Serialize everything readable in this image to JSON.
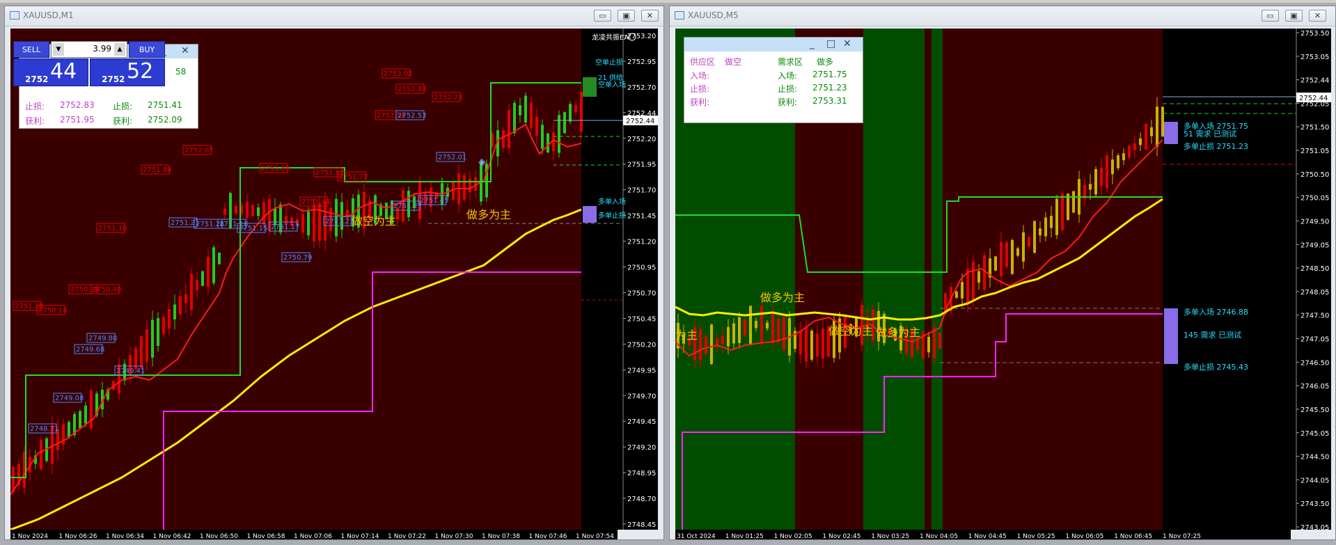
{
  "windows": [
    {
      "title": "XAUUSD,M1",
      "ea_label": "龙凌共振EA",
      "price_axis": [
        "2753.20",
        "2752.95",
        "2752.70",
        "2752.44",
        "2752.20",
        "2751.95",
        "2751.70",
        "2751.45",
        "2751.20",
        "2750.95",
        "2750.70",
        "2750.45",
        "2750.20",
        "2749.95",
        "2749.70",
        "2749.45",
        "2749.20",
        "2748.95",
        "2748.70",
        "2748.45"
      ],
      "current_price": "2752.44",
      "time_axis": [
        "1 Nov 2024",
        "1 Nov 06:26",
        "1 Nov 06:34",
        "1 Nov 06:42",
        "1 Nov 06:50",
        "1 Nov 06:58",
        "1 Nov 07:06",
        "1 Nov 07:14",
        "1 Nov 07:22",
        "1 Nov 07:30",
        "1 Nov 07:38",
        "1 Nov 07:46",
        "1 Nov 07:54"
      ],
      "trade_panel": {
        "sell_label": "SELL",
        "buy_label": "BUY",
        "lot": "3.99",
        "sell_small": "2752",
        "sell_big": "44",
        "buy_small": "2752",
        "buy_big": "52",
        "partial_value": "58"
      },
      "info": {
        "sl_left_label": "止损:",
        "sl_left_value": "2752.83",
        "tp_left_label": "获利:",
        "tp_left_value": "2751.95",
        "sl_right_label": "止损:",
        "sl_right_value": "2751.41",
        "tp_right_label": "获利:",
        "tp_right_value": "2752.09"
      },
      "red_labels": [
        "2753.02",
        "2752.83",
        "2752.73",
        "2752.54",
        "2752.07",
        "2751.84",
        "2751.89",
        "2751.82",
        "2751.73",
        "2751.48",
        "2751.10",
        "2750.39",
        "2750.40",
        "2750.14",
        "2751.28"
      ],
      "blue_labels": [
        "2752.53",
        "2752.01",
        "2751.45",
        "2751.27",
        "2751.21",
        "2751.26",
        "2751.18",
        "2751.15",
        "2751.17",
        "2751.23",
        "2750.79",
        "2749.80",
        "2749.68",
        "2749.41",
        "2749.08",
        "2748.71"
      ],
      "chart_text": {
        "short_bias": "做空为主",
        "long_bias": "做多为主"
      },
      "right_labels": [
        "空单止损",
        "21 供给",
        "空单入场",
        "多单入场",
        "多单止损"
      ]
    },
    {
      "title": "XAUUSD,M5",
      "price_axis": [
        "2753.50",
        "2753.05",
        "2752.44",
        "2752.05",
        "2751.50",
        "2751.05",
        "2750.50",
        "2750.05",
        "2749.50",
        "2749.05",
        "2748.50",
        "2748.05",
        "2747.50",
        "2747.05",
        "2746.50",
        "2746.05",
        "2745.50",
        "2745.05",
        "2744.50",
        "2744.05",
        "2743.50",
        "2743.05"
      ],
      "current_price": "2752.44",
      "time_axis": [
        "31 Oct 2024",
        "1 Nov 01:25",
        "1 Nov 02:05",
        "1 Nov 02:45",
        "1 Nov 03:25",
        "1 Nov 04:05",
        "1 Nov 04:45",
        "1 Nov 05:25",
        "1 Nov 06:05",
        "1 Nov 06:45",
        "1 Nov 07:25"
      ],
      "info": {
        "supply_label": "供应区",
        "supply_dir": "做空",
        "demand_label": "需求区",
        "demand_dir": "做多",
        "entry_left_label": "入场:",
        "entry_left_value": "",
        "sl_left_label": "止损:",
        "tp_left_label": "获利:",
        "entry_right_label": "入场:",
        "entry_right_value": "2751.75",
        "sl_right_label": "止损:",
        "sl_right_value": "2751.23",
        "tp_right_label": "获利:",
        "tp_right_value": "2753.31"
      },
      "chart_text": {
        "partial_bias": "为主",
        "long_bias_1": "做多为主",
        "short_bias": "做空为主",
        "long_bias_2": "做多为主"
      },
      "right_labels": {
        "upper_entry": "多单入场 2751.75",
        "upper_zone": "51 需求 已测试",
        "upper_sl": "多单止损 2751.23",
        "lower_entry": "多单入场 2746.88",
        "lower_zone": "145 需求 已测试",
        "lower_sl": "多单止损 2745.43"
      }
    }
  ],
  "colors": {
    "bg_dark_red": "#3a0000",
    "bg_green": "#004d00",
    "bull_candle": "#22cc22",
    "bear_candle": "#e00000",
    "ma_fast": "#ff1a1a",
    "ma_slow": "#ffee00",
    "level_green": "#22dd22",
    "level_magenta": "#ff22ff",
    "text_cyan": "#22e0ff",
    "text_yellow": "#f2c300"
  }
}
